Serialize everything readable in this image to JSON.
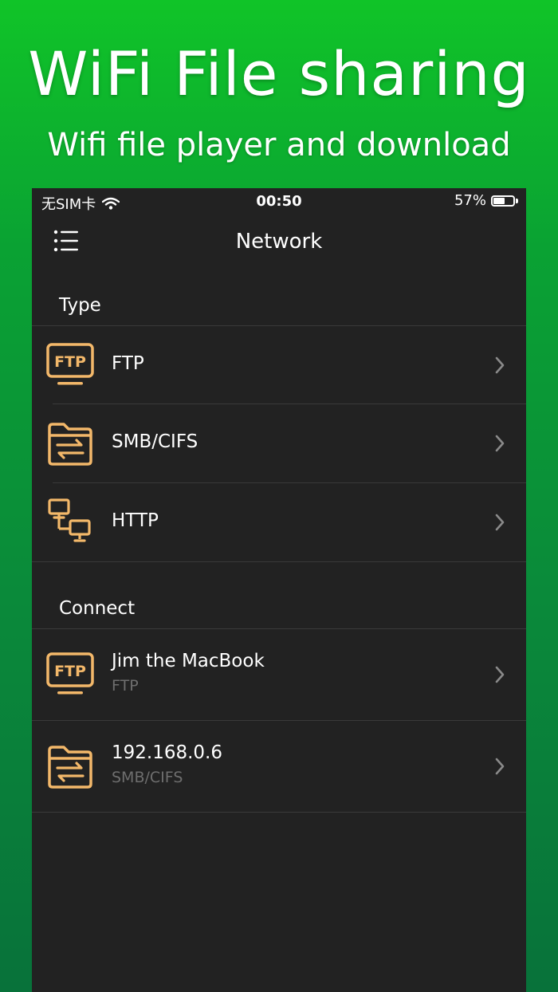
{
  "promo": {
    "title": "WiFi File sharing",
    "subtitle": "Wifi file player and download"
  },
  "status_bar": {
    "carrier": "无SIM卡",
    "time": "00:50",
    "battery_percent": "57%",
    "battery_level": 0.57
  },
  "nav": {
    "title": "Network"
  },
  "sections": {
    "type_header": "Type",
    "connect_header": "Connect"
  },
  "type_items": [
    {
      "label": "FTP",
      "icon": "ftp-icon"
    },
    {
      "label": "SMB/CIFS",
      "icon": "folder-transfer-icon"
    },
    {
      "label": "HTTP",
      "icon": "network-computers-icon"
    }
  ],
  "connect_items": [
    {
      "title": "Jim the MacBook",
      "subtitle": "FTP",
      "icon": "ftp-icon"
    },
    {
      "title": "192.168.0.6",
      "subtitle": "SMB/CIFS",
      "icon": "folder-transfer-icon"
    }
  ],
  "colors": {
    "accent_icon": "#f3b86a",
    "panel_bg": "#222222",
    "gradient_top": "#10c428",
    "gradient_bottom": "#08723a"
  }
}
